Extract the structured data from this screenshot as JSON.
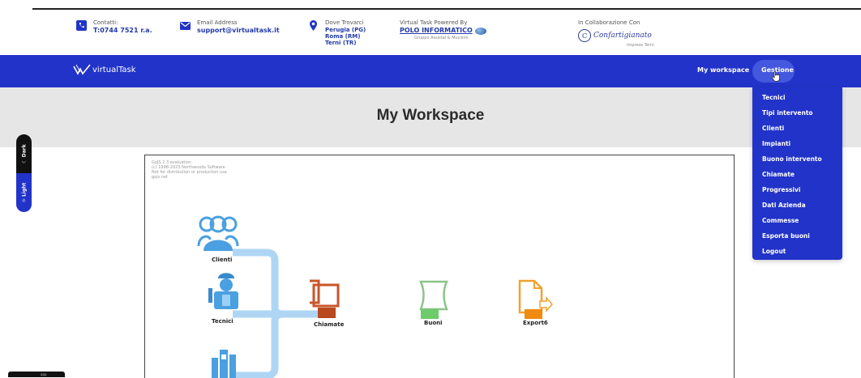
{
  "contact": {
    "phone": {
      "label": "Contatti:",
      "value": "T:0744 7521 r.a."
    },
    "email": {
      "label": "Email Address",
      "value": "support@virtualtask.it"
    },
    "address": {
      "label": "Dove Trovarci",
      "lines": [
        "Perugia (PG)",
        "Roma (RM)",
        "Terni (TR)"
      ]
    },
    "powered": {
      "label": "Virtual Task Powered By",
      "logo": "POLO INFORMATICO",
      "logo_sub": "Gruppo Assistal & Mucisini"
    },
    "collab": {
      "label": "In Collaborazione Con",
      "logo": "Confartigianato",
      "logo_sub": "Imprese Terni"
    }
  },
  "navbar": {
    "brand": "virtualTask",
    "links": [
      {
        "label": "My workspace"
      },
      {
        "label": "Gestione"
      }
    ]
  },
  "hero": {
    "title": "My Workspace"
  },
  "theme_toggle": {
    "dark": "Dark",
    "light": "Light"
  },
  "diagram": {
    "eval_note": [
      "GoJS 2.3 evaluation",
      "(c) 1998-2023 Northwoods Software",
      "Not for distribution or production use",
      "gojs.net"
    ],
    "nodes": [
      {
        "label": "Clienti"
      },
      {
        "label": "Tecnici"
      },
      {
        "label": "Chiamate"
      },
      {
        "label": "Buoni"
      },
      {
        "label": "Export6"
      }
    ]
  },
  "dropdown": {
    "items": [
      "Tecnici",
      "Tipi intervento",
      "Clienti",
      "Impianti",
      "Buono intervento",
      "Chiamate",
      "Progressivi",
      "Dati Azienda",
      "Commesse",
      "Esporta buoni",
      "Logout"
    ]
  },
  "status_tab": "app"
}
